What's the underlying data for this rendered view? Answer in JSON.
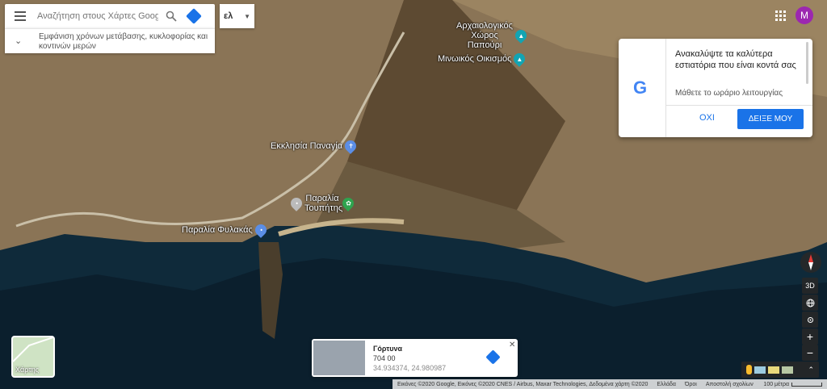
{
  "search": {
    "placeholder": "Αναζήτηση στους Χάρτες Google"
  },
  "traffic_hint": "Εμφάνιση χρόνων μετάβασης, κυκλοφορίας και κοντινών μερών",
  "language": "ελ",
  "avatar": "M",
  "places": {
    "archaeological": "Αρχαιολογικός Χώρος Παπούρι",
    "minoan": "Μινωικός Οικισμός",
    "church": "Εκκλησία Παναγία",
    "beach_toupitis": "Παραλία Τουπήτης",
    "beach_fylakas": "Παραλία Φυλακάς"
  },
  "promo": {
    "title": "Ανακαλύψτε τα καλύτερα εστιατόρια που είναι κοντά σας",
    "subtitle": "Μάθετε το ωράριο λειτουργίας",
    "no_label": "ΟΧΙ",
    "yes_label": "ΔΕΙΞΕ ΜΟΥ"
  },
  "controls": {
    "view3d": "3D",
    "zoom_in": "+",
    "zoom_out": "−"
  },
  "layer_toggle": "Χάρτης",
  "place_card": {
    "title": "Γόρτυνα",
    "code": "704 00",
    "coords": "34.934374, 24.980987",
    "close": "✕"
  },
  "street_view": {
    "expand": "⌃"
  },
  "footer": {
    "imagery": "Εικόνες ©2020 Google, Εικόνες ©2020 CNES / Airbus, Maxar Technologies, Δεδομένα χάρτη ©2020",
    "country": "Ελλάδα",
    "terms": "Όροι",
    "feedback": "Αποστολή σχολίων",
    "scale": "100 μέτρα"
  }
}
